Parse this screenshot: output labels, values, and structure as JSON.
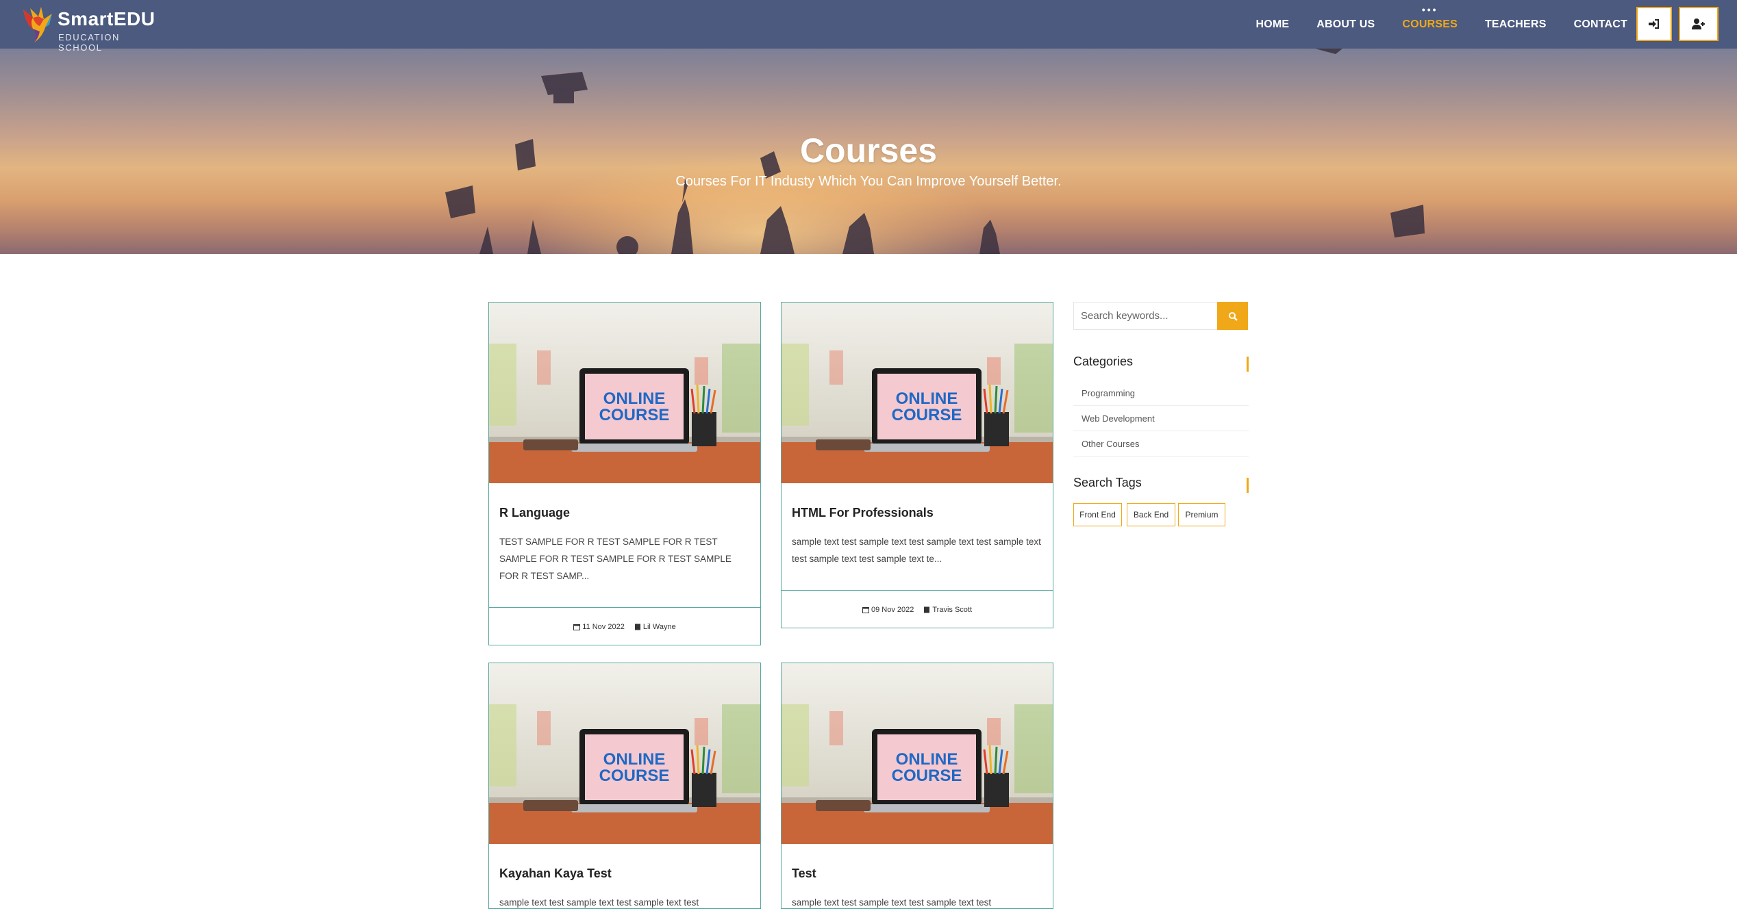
{
  "brand": {
    "name": "SmartEDU",
    "tagline": "EDUCATION SCHOOL"
  },
  "nav": {
    "items": [
      {
        "label": "HOME",
        "active": false
      },
      {
        "label": "ABOUT US",
        "active": false
      },
      {
        "label": "COURSES",
        "active": true
      },
      {
        "label": "TEACHERS",
        "active": false
      },
      {
        "label": "CONTACT",
        "active": false
      }
    ],
    "login_icon": "sign-in-icon",
    "register_icon": "user-plus-icon"
  },
  "hero": {
    "title": "Courses",
    "subtitle": "Courses For IT Industy Which You Can Improve Yourself Better."
  },
  "courses": [
    {
      "title": "R Language",
      "excerpt": "TEST SAMPLE FOR R TEST SAMPLE FOR R TEST SAMPLE FOR R TEST SAMPLE FOR R TEST SAMPLE FOR R TEST SAMP...",
      "date": "11 Nov 2022",
      "author": "Lil Wayne",
      "image_text": "ONLINE COURSE"
    },
    {
      "title": "HTML For Professionals",
      "excerpt": "sample text test sample text test sample text test sample text test sample text test sample text te...",
      "date": "09 Nov 2022",
      "author": "Travis Scott",
      "image_text": "ONLINE COURSE"
    },
    {
      "title": "Kayahan Kaya Test",
      "excerpt": "sample text test sample text test sample text test",
      "date": "",
      "author": "",
      "image_text": "ONLINE COURSE"
    },
    {
      "title": "Test",
      "excerpt": "sample text test sample text test sample text test",
      "date": "",
      "author": "",
      "image_text": "ONLINE COURSE"
    }
  ],
  "sidebar": {
    "search_placeholder": "Search keywords...",
    "categories_title": "Categories",
    "categories": [
      "Programming",
      "Web Development",
      "Other Courses"
    ],
    "tags_title": "Search Tags",
    "tags": [
      "Front End",
      "Back End",
      "Premium"
    ]
  },
  "colors": {
    "nav_bg": "#4b5a7e",
    "accent": "#f0a818",
    "card_border": "#57a9a2"
  }
}
